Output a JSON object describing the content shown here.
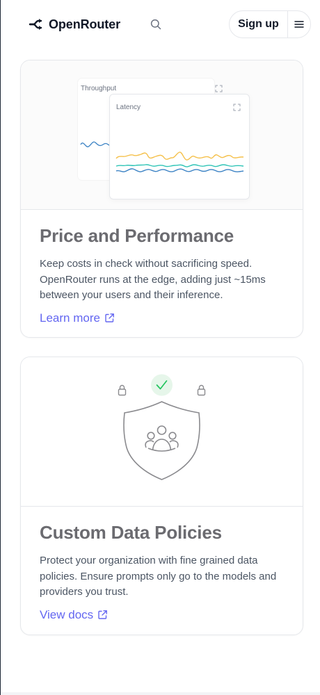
{
  "header": {
    "brand": "OpenRouter",
    "signup_label": "Sign up",
    "icons": {
      "logo": "openrouter-logo-icon",
      "search": "search-icon",
      "menu": "hamburger-menu-icon"
    }
  },
  "cards": [
    {
      "title": "Price and Performance",
      "description": "Keep costs in check without sacrificing speed. OpenRouter runs at the edge, adding just ~15ms between your users and their inference.",
      "link_label": "Learn more",
      "link_icon": "external-link-icon",
      "illustration": {
        "back_panel_title": "Throughput",
        "front_panel_title": "Latency",
        "expand_icon": "expand-icon"
      }
    },
    {
      "title": "Custom Data Policies",
      "description": "Protect your organization with fine grained data policies. Ensure prompts only go to the models and providers you trust.",
      "link_label": "View docs",
      "link_icon": "external-link-icon",
      "illustration": {
        "icons": [
          "lock-icon",
          "check-icon",
          "lock-icon",
          "shield-icon",
          "users-group-icon"
        ]
      }
    }
  ],
  "colors": {
    "accent": "#6366f1",
    "series_yellow": "#f5c04a",
    "series_teal": "#2ec4b6",
    "series_blue": "#3b82c4",
    "check_green": "#22c55e"
  }
}
